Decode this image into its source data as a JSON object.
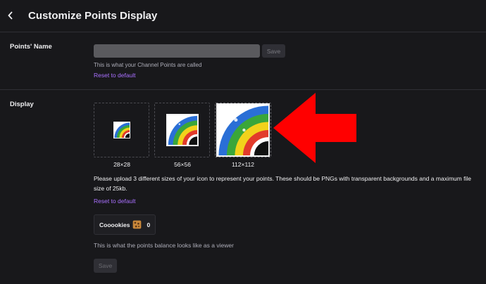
{
  "header": {
    "title": "Customize Points Display",
    "back_icon": "chevron-left-icon"
  },
  "points_name": {
    "label": "Points' Name",
    "input_value": "",
    "save_label": "Save",
    "helper": "This is what your Channel Points are called",
    "reset_label": "Reset to default"
  },
  "display": {
    "label": "Display",
    "icons": [
      {
        "size_label": "28×28"
      },
      {
        "size_label": "56×56"
      },
      {
        "size_label": "112×112"
      }
    ],
    "description": "Please upload 3 different sizes of your icon to represent your points. These should be PNGs with transparent backgrounds and a maximum file size of 25kb.",
    "reset_label": "Reset to default",
    "balance_name": "Cooookies",
    "balance_value": "0",
    "balance_helper": "This is what the points balance looks like as a viewer",
    "save_label": "Save"
  },
  "colors": {
    "background": "#18181b",
    "accent_link": "#a970ff",
    "arrow": "#ff0000"
  }
}
